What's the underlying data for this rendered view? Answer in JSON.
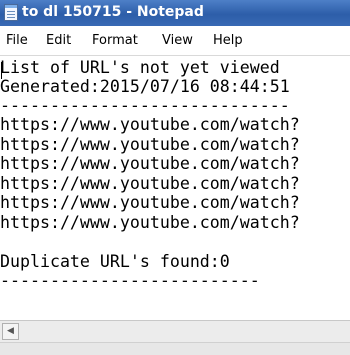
{
  "window": {
    "title": "to dl 150715 - Notepad"
  },
  "menu": {
    "items": [
      "File",
      "Edit",
      "Format",
      "View",
      "Help"
    ]
  },
  "document": {
    "lines": [
      "List of URL's not yet viewed",
      "Generated:2015/07/16 08:44:51",
      "-----------------------------",
      "https://www.youtube.com/watch?",
      "https://www.youtube.com/watch?",
      "https://www.youtube.com/watch?",
      "https://www.youtube.com/watch?",
      "https://www.youtube.com/watch?",
      "https://www.youtube.com/watch?",
      "",
      "Duplicate URL's found:0",
      "--------------------------"
    ]
  },
  "scrollbar": {
    "left_arrow_icon": "scroll-left-arrow-icon"
  }
}
